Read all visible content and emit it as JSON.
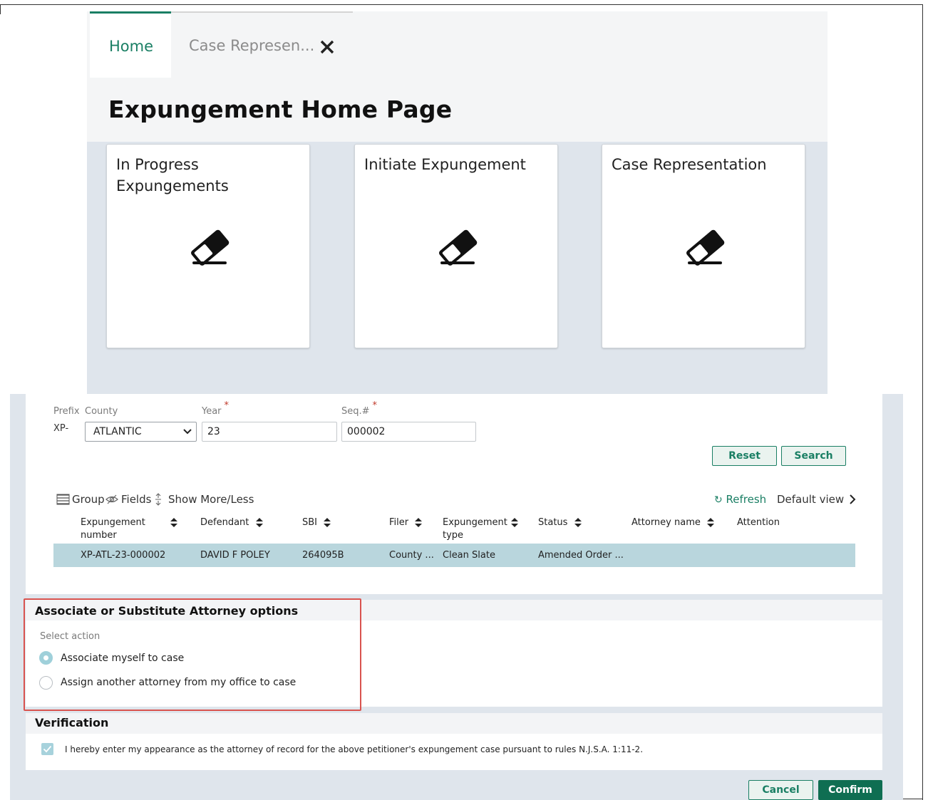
{
  "tabs": {
    "home_label": "Home",
    "case_label": "Case Represen..."
  },
  "page_title": "Expungement Home Page",
  "tiles": [
    {
      "label": "In Progress Expungements",
      "icon": "eraser-icon"
    },
    {
      "label": "Initiate Expungement",
      "icon": "eraser-icon"
    },
    {
      "label": "Case Representation",
      "icon": "eraser-icon"
    }
  ],
  "search_form": {
    "prefix_label": "Prefix",
    "prefix_value": "XP-",
    "county_label": "County",
    "county_value": "ATLANTIC",
    "year_label": "Year",
    "year_value": "23",
    "seq_label": "Seq.#",
    "seq_value": "000002",
    "required_mark": "*",
    "reset_label": "Reset",
    "search_label": "Search"
  },
  "grid_toolbar": {
    "group_label": "Group",
    "fields_label": "Fields",
    "show_more_label": "Show More/Less",
    "refresh_label": "Refresh",
    "default_view_label": "Default view"
  },
  "table": {
    "headers": {
      "expungement_number_1": "Expungement",
      "expungement_number_2": "number",
      "defendant": "Defendant",
      "sbi": "SBI",
      "filer": "Filer",
      "expungement_type_1": "Expungement",
      "expungement_type_2": "type",
      "status": "Status",
      "attorney_name": "Attorney name",
      "attention": "Attention"
    },
    "rows": [
      {
        "expungement_number": "XP-ATL-23-000002",
        "defendant": "DAVID F POLEY",
        "sbi": "264095B",
        "filer": "County ...",
        "expungement_type": "Clean Slate",
        "status": "Amended Order ...",
        "attorney_name": "",
        "attention": ""
      }
    ]
  },
  "attorney_options": {
    "title": "Associate or Substitute Attorney options",
    "select_action_label": "Select action",
    "option_1": "Associate myself to case",
    "option_2": "Assign another attorney from my office to case",
    "selected": "option_1"
  },
  "verification": {
    "title": "Verification",
    "text": "I hereby enter my appearance as the attorney of record for the above petitioner's expungement case pursuant to rules N.J.S.A. 1:11-2.",
    "checked": true
  },
  "footer": {
    "cancel_label": "Cancel",
    "confirm_label": "Confirm"
  },
  "colors": {
    "accent": "#1a7f64",
    "selected_row": "#b9d6dd",
    "highlight_box": "#d9534f"
  }
}
